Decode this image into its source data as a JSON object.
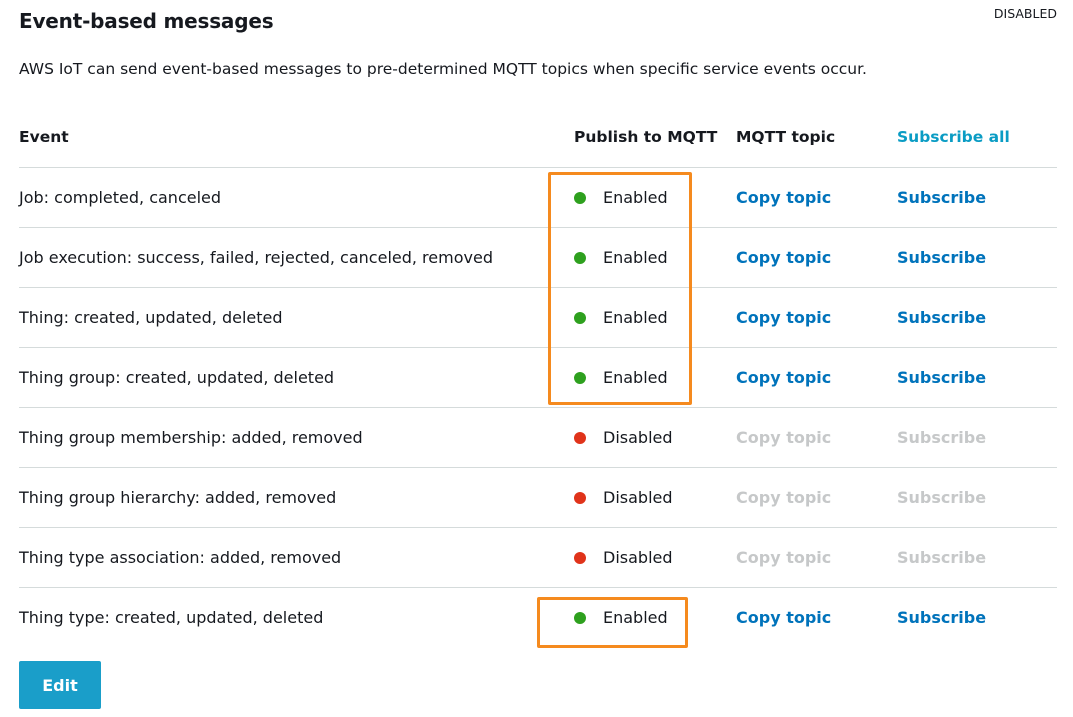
{
  "header": {
    "title": "Event-based messages",
    "status": "DISABLED",
    "description": "AWS IoT can send event-based messages to pre-determined MQTT topics when specific service events occur."
  },
  "table": {
    "columns": {
      "event": "Event",
      "publish": "Publish to MQTT",
      "topic": "MQTT topic",
      "subscribe_all": "Subscribe all"
    },
    "rows": [
      {
        "event": "Job: completed, canceled",
        "status": "Enabled",
        "copy": "Copy topic",
        "subscribe": "Subscribe",
        "enabled": true
      },
      {
        "event": "Job execution: success, failed, rejected, canceled, removed",
        "status": "Enabled",
        "copy": "Copy topic",
        "subscribe": "Subscribe",
        "enabled": true
      },
      {
        "event": "Thing: created, updated, deleted",
        "status": "Enabled",
        "copy": "Copy topic",
        "subscribe": "Subscribe",
        "enabled": true
      },
      {
        "event": "Thing group: created, updated, deleted",
        "status": "Enabled",
        "copy": "Copy topic",
        "subscribe": "Subscribe",
        "enabled": true
      },
      {
        "event": "Thing group membership: added, removed",
        "status": "Disabled",
        "copy": "Copy topic",
        "subscribe": "Subscribe",
        "enabled": false
      },
      {
        "event": "Thing group hierarchy: added, removed",
        "status": "Disabled",
        "copy": "Copy topic",
        "subscribe": "Subscribe",
        "enabled": false
      },
      {
        "event": "Thing type association: added, removed",
        "status": "Disabled",
        "copy": "Copy topic",
        "subscribe": "Subscribe",
        "enabled": false
      },
      {
        "event": "Thing type: created, updated, deleted",
        "status": "Enabled",
        "copy": "Copy topic",
        "subscribe": "Subscribe",
        "enabled": true
      }
    ]
  },
  "footer": {
    "edit_label": "Edit"
  },
  "colors": {
    "enabled_dot": "#2ea01e",
    "disabled_dot": "#e0331a",
    "link": "#0073bb",
    "link_disabled": "#c6c8c9",
    "highlight": "#f58a1e",
    "edit_button": "#1a9ec9"
  }
}
